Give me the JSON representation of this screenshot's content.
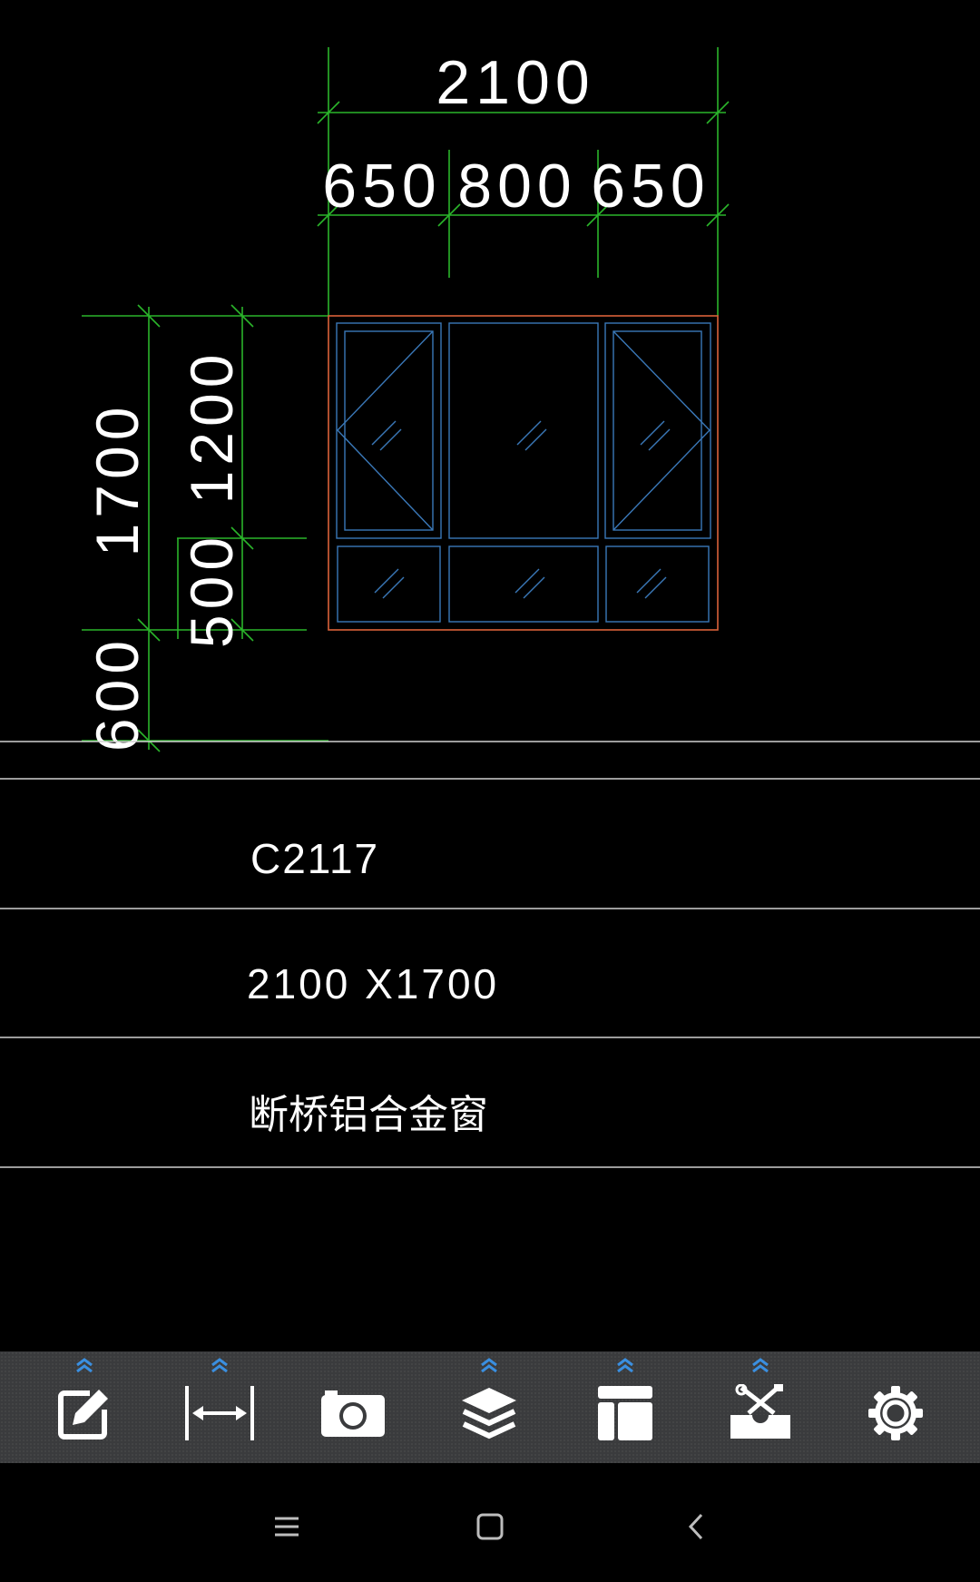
{
  "drawing": {
    "dimensions": {
      "overall_width": "2100",
      "left_panel_width": "650",
      "center_panel_width": "800",
      "right_panel_width": "650",
      "overall_height": "1700",
      "upper_height": "1200",
      "lower_height": "500",
      "sill_height": "600"
    },
    "schedule": {
      "code": "C2117",
      "size": "2100 X1700",
      "material": "断桥铝合金窗"
    },
    "colors": {
      "dimension_lines": "#2bb52b",
      "frame_outer": "#d9623a",
      "sash_lines": "#3a78b8",
      "table_lines": "#cfcfcf",
      "text": "#ffffff"
    }
  },
  "toolbar": {
    "items": [
      {
        "icon": "edit-icon",
        "expandable": true
      },
      {
        "icon": "measure-icon",
        "expandable": true
      },
      {
        "icon": "camera-icon",
        "expandable": false
      },
      {
        "icon": "layers-icon",
        "expandable": true
      },
      {
        "icon": "layout-icon",
        "expandable": true
      },
      {
        "icon": "tools-icon",
        "expandable": true
      },
      {
        "icon": "gear-icon",
        "expandable": false
      }
    ],
    "expand_color": "#3a8fe0"
  },
  "navigation": {
    "items": [
      "menu-icon",
      "home-icon",
      "back-icon"
    ]
  }
}
